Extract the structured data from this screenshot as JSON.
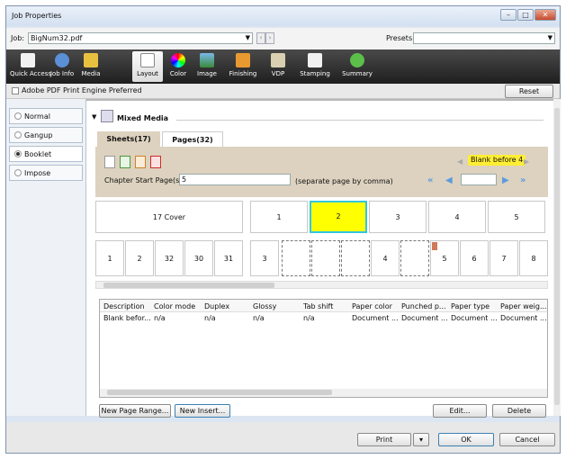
{
  "window": {
    "title": "Job Properties"
  },
  "job": {
    "label": "Job:",
    "value": "BigNum32.pdf",
    "presets_label": "Presets:",
    "presets_value": ""
  },
  "toolbar": [
    {
      "label": "Quick Access",
      "icon": "document-icon"
    },
    {
      "label": "Job Info",
      "icon": "info-icon"
    },
    {
      "label": "Media",
      "icon": "media-icon"
    },
    {
      "label": "Layout",
      "icon": "layout-icon",
      "selected": true
    },
    {
      "label": "Color",
      "icon": "color-wheel-icon"
    },
    {
      "label": "Image",
      "icon": "image-icon"
    },
    {
      "label": "Finishing",
      "icon": "finishing-icon"
    },
    {
      "label": "VDP",
      "icon": "vdp-icon"
    },
    {
      "label": "Stamping",
      "icon": "stamp-icon"
    },
    {
      "label": "Summary",
      "icon": "check-icon"
    }
  ],
  "options": {
    "pdf_engine": "Adobe PDF Print Engine Preferred",
    "reset": "Reset"
  },
  "modes": [
    {
      "label": "Normal",
      "selected": false
    },
    {
      "label": "Gangup",
      "selected": false
    },
    {
      "label": "Booklet",
      "selected": true
    },
    {
      "label": "Impose",
      "selected": false
    }
  ],
  "section": {
    "title": "Mixed Media"
  },
  "tabs": {
    "sheets": "Sheets(17)",
    "pages": "Pages(32)"
  },
  "insert_badge": "Blank before 4",
  "chapter": {
    "label": "Chapter Start Page(s):",
    "value": "5",
    "hint": "(separate page by comma)"
  },
  "sheets_row": {
    "cover": "17 Cover",
    "pages": [
      "1",
      "2",
      "3",
      "4",
      "5"
    ]
  },
  "pages_row": {
    "left": [
      "1",
      "2",
      "32",
      "30",
      "31"
    ],
    "right": [
      "3",
      "",
      "",
      "",
      "4",
      "",
      "5",
      "6",
      "7",
      "8"
    ]
  },
  "table": {
    "headers": [
      "Description",
      "Color mode",
      "Duplex",
      "Glossy",
      "Tab shift",
      "Paper color",
      "Punched p...",
      "Paper type",
      "Paper weig..."
    ],
    "rows": [
      [
        "Blank befor...",
        "n/a",
        "n/a",
        "n/a",
        "n/a",
        "Document ...",
        "Document ...",
        "Document ...",
        "Document ..."
      ]
    ]
  },
  "actions": {
    "new_range": "New Page Range...",
    "new_insert": "New Insert...",
    "edit": "Edit...",
    "delete": "Delete"
  },
  "footer": {
    "print": "Print",
    "ok": "OK",
    "cancel": "Cancel"
  }
}
